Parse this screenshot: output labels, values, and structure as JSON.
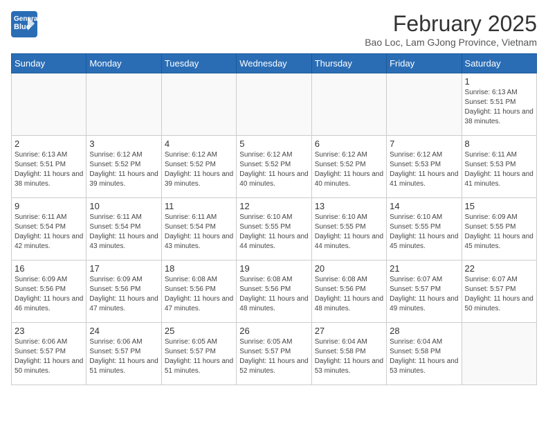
{
  "header": {
    "logo_general": "General",
    "logo_blue": "Blue",
    "month": "February 2025",
    "location": "Bao Loc, Lam GJong Province, Vietnam"
  },
  "days_of_week": [
    "Sunday",
    "Monday",
    "Tuesday",
    "Wednesday",
    "Thursday",
    "Friday",
    "Saturday"
  ],
  "weeks": [
    [
      {
        "day": "",
        "info": ""
      },
      {
        "day": "",
        "info": ""
      },
      {
        "day": "",
        "info": ""
      },
      {
        "day": "",
        "info": ""
      },
      {
        "day": "",
        "info": ""
      },
      {
        "day": "",
        "info": ""
      },
      {
        "day": "1",
        "info": "Sunrise: 6:13 AM\nSunset: 5:51 PM\nDaylight: 11 hours and 38 minutes."
      }
    ],
    [
      {
        "day": "2",
        "info": "Sunrise: 6:13 AM\nSunset: 5:51 PM\nDaylight: 11 hours and 38 minutes."
      },
      {
        "day": "3",
        "info": "Sunrise: 6:12 AM\nSunset: 5:52 PM\nDaylight: 11 hours and 39 minutes."
      },
      {
        "day": "4",
        "info": "Sunrise: 6:12 AM\nSunset: 5:52 PM\nDaylight: 11 hours and 39 minutes."
      },
      {
        "day": "5",
        "info": "Sunrise: 6:12 AM\nSunset: 5:52 PM\nDaylight: 11 hours and 40 minutes."
      },
      {
        "day": "6",
        "info": "Sunrise: 6:12 AM\nSunset: 5:52 PM\nDaylight: 11 hours and 40 minutes."
      },
      {
        "day": "7",
        "info": "Sunrise: 6:12 AM\nSunset: 5:53 PM\nDaylight: 11 hours and 41 minutes."
      },
      {
        "day": "8",
        "info": "Sunrise: 6:11 AM\nSunset: 5:53 PM\nDaylight: 11 hours and 41 minutes."
      }
    ],
    [
      {
        "day": "9",
        "info": "Sunrise: 6:11 AM\nSunset: 5:54 PM\nDaylight: 11 hours and 42 minutes."
      },
      {
        "day": "10",
        "info": "Sunrise: 6:11 AM\nSunset: 5:54 PM\nDaylight: 11 hours and 43 minutes."
      },
      {
        "day": "11",
        "info": "Sunrise: 6:11 AM\nSunset: 5:54 PM\nDaylight: 11 hours and 43 minutes."
      },
      {
        "day": "12",
        "info": "Sunrise: 6:10 AM\nSunset: 5:55 PM\nDaylight: 11 hours and 44 minutes."
      },
      {
        "day": "13",
        "info": "Sunrise: 6:10 AM\nSunset: 5:55 PM\nDaylight: 11 hours and 44 minutes."
      },
      {
        "day": "14",
        "info": "Sunrise: 6:10 AM\nSunset: 5:55 PM\nDaylight: 11 hours and 45 minutes."
      },
      {
        "day": "15",
        "info": "Sunrise: 6:09 AM\nSunset: 5:55 PM\nDaylight: 11 hours and 45 minutes."
      }
    ],
    [
      {
        "day": "16",
        "info": "Sunrise: 6:09 AM\nSunset: 5:56 PM\nDaylight: 11 hours and 46 minutes."
      },
      {
        "day": "17",
        "info": "Sunrise: 6:09 AM\nSunset: 5:56 PM\nDaylight: 11 hours and 47 minutes."
      },
      {
        "day": "18",
        "info": "Sunrise: 6:08 AM\nSunset: 5:56 PM\nDaylight: 11 hours and 47 minutes."
      },
      {
        "day": "19",
        "info": "Sunrise: 6:08 AM\nSunset: 5:56 PM\nDaylight: 11 hours and 48 minutes."
      },
      {
        "day": "20",
        "info": "Sunrise: 6:08 AM\nSunset: 5:56 PM\nDaylight: 11 hours and 48 minutes."
      },
      {
        "day": "21",
        "info": "Sunrise: 6:07 AM\nSunset: 5:57 PM\nDaylight: 11 hours and 49 minutes."
      },
      {
        "day": "22",
        "info": "Sunrise: 6:07 AM\nSunset: 5:57 PM\nDaylight: 11 hours and 50 minutes."
      }
    ],
    [
      {
        "day": "23",
        "info": "Sunrise: 6:06 AM\nSunset: 5:57 PM\nDaylight: 11 hours and 50 minutes."
      },
      {
        "day": "24",
        "info": "Sunrise: 6:06 AM\nSunset: 5:57 PM\nDaylight: 11 hours and 51 minutes."
      },
      {
        "day": "25",
        "info": "Sunrise: 6:05 AM\nSunset: 5:57 PM\nDaylight: 11 hours and 51 minutes."
      },
      {
        "day": "26",
        "info": "Sunrise: 6:05 AM\nSunset: 5:57 PM\nDaylight: 11 hours and 52 minutes."
      },
      {
        "day": "27",
        "info": "Sunrise: 6:04 AM\nSunset: 5:58 PM\nDaylight: 11 hours and 53 minutes."
      },
      {
        "day": "28",
        "info": "Sunrise: 6:04 AM\nSunset: 5:58 PM\nDaylight: 11 hours and 53 minutes."
      },
      {
        "day": "",
        "info": ""
      }
    ]
  ]
}
